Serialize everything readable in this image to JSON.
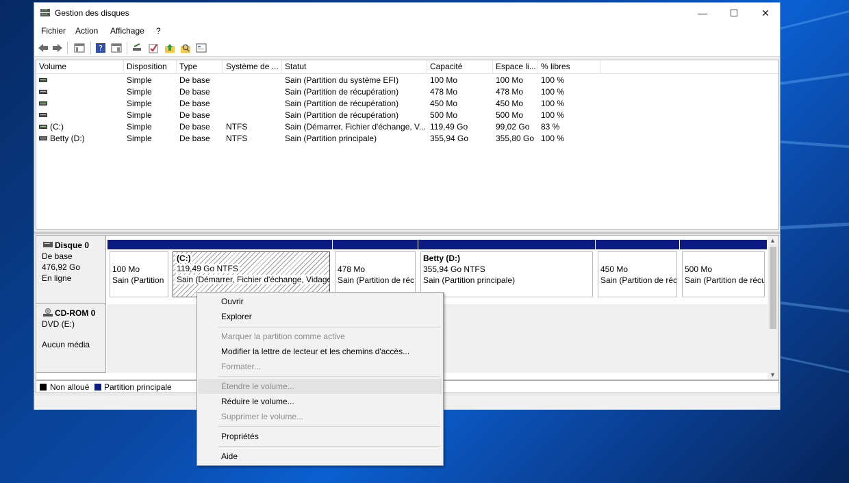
{
  "window": {
    "title": "Gestion des disques",
    "minimize": "—",
    "maximize": "☐",
    "close": "✕"
  },
  "menu": [
    "Fichier",
    "Action",
    "Affichage",
    "?"
  ],
  "toolbar_icons": [
    "back-arrow-icon",
    "forward-arrow-icon",
    "console-tree-icon",
    "help-icon",
    "properties-view-icon",
    "connect-drive-icon",
    "check-icon",
    "upload-folder-icon",
    "search-folder-icon",
    "settings-list-icon"
  ],
  "volume_list": {
    "columns": [
      "Volume",
      "Disposition",
      "Type",
      "Système de ...",
      "Statut",
      "Capacité",
      "Espace li...",
      "% libres"
    ],
    "rows": [
      [
        "",
        "Simple",
        "De base",
        "",
        "Sain (Partition du système EFI)",
        "100 Mo",
        "100 Mo",
        "100 %"
      ],
      [
        "",
        "Simple",
        "De base",
        "",
        "Sain (Partition de récupération)",
        "478 Mo",
        "478 Mo",
        "100 %"
      ],
      [
        "",
        "Simple",
        "De base",
        "",
        "Sain (Partition de récupération)",
        "450 Mo",
        "450 Mo",
        "100 %"
      ],
      [
        "",
        "Simple",
        "De base",
        "",
        "Sain (Partition de récupération)",
        "500 Mo",
        "500 Mo",
        "100 %"
      ],
      [
        "(C:)",
        "Simple",
        "De base",
        "NTFS",
        "Sain (Démarrer, Fichier d'échange, V...",
        "119,49 Go",
        "99,02 Go",
        "83 %"
      ],
      [
        "Betty (D:)",
        "Simple",
        "De base",
        "NTFS",
        "Sain (Partition principale)",
        "355,94 Go",
        "355,80 Go",
        "100 %"
      ]
    ]
  },
  "disks": {
    "disk0": {
      "name": "Disque 0",
      "type": "De base",
      "size": "476,92 Go",
      "state": "En ligne",
      "partitions": [
        {
          "name": "",
          "size": "100 Mo",
          "status": "Sain (Partition"
        },
        {
          "name": "(C:)",
          "size": "119,49 Go NTFS",
          "status": "Sain (Démarrer, Fichier d'échange, Vidage"
        },
        {
          "name": "",
          "size": "478 Mo",
          "status": "Sain (Partition de réc"
        },
        {
          "name": "Betty  (D:)",
          "size": "355,94 Go NTFS",
          "status": "Sain (Partition principale)"
        },
        {
          "name": "",
          "size": "450 Mo",
          "status": "Sain (Partition de réc"
        },
        {
          "name": "",
          "size": "500 Mo",
          "status": "Sain (Partition de récu"
        }
      ]
    },
    "cdrom0": {
      "name": "CD-ROM 0",
      "type": "DVD (E:)",
      "media": "Aucun média"
    }
  },
  "legend": [
    {
      "label": "Non alloué",
      "color": "#000000"
    },
    {
      "label": "Partition principale",
      "color": "#0c1a84"
    }
  ],
  "context_menu": {
    "items": [
      {
        "label": "Ouvrir",
        "enabled": true
      },
      {
        "label": "Explorer",
        "enabled": true
      },
      {
        "label": "Marquer la partition comme active",
        "enabled": false
      },
      {
        "label": "Modifier la lettre de lecteur et les chemins d'accès...",
        "enabled": true
      },
      {
        "label": "Formater...",
        "enabled": false
      },
      {
        "label": "Étendre le volume...",
        "enabled": false,
        "highlighted": true
      },
      {
        "label": "Réduire le volume...",
        "enabled": true
      },
      {
        "label": "Supprimer le volume...",
        "enabled": false
      },
      {
        "label": "Propriétés",
        "enabled": true
      },
      {
        "label": "Aide",
        "enabled": true
      }
    ]
  }
}
